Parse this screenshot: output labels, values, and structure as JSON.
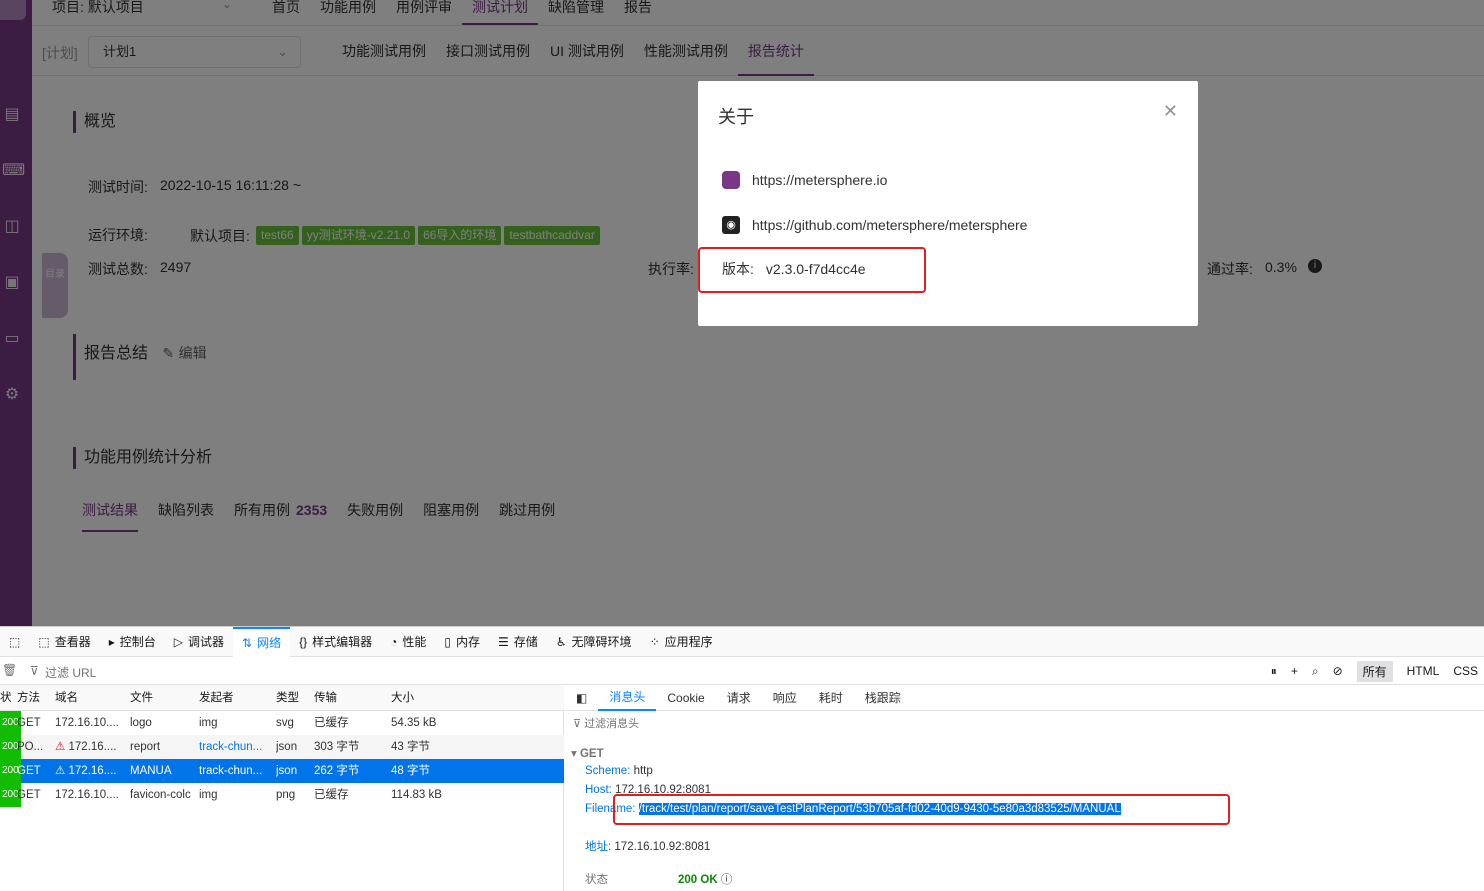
{
  "topbar": {
    "project": "项目: 默认项目",
    "nav": [
      "首页",
      "功能用例",
      "用例评审",
      "测试计划",
      "缺陷管理",
      "报告"
    ]
  },
  "subbar": {
    "plan_tag": "[计划]",
    "plan_value": "计划1",
    "tabs": [
      "功能测试用例",
      "接口测试用例",
      "UI 测试用例",
      "性能测试用例",
      "报告统计"
    ]
  },
  "overview": {
    "title": "概览",
    "test_time_label": "测试时间:",
    "test_time_value": "2022-10-15 16:11:28 ~",
    "env_label": "运行环境:",
    "env_project": "默认项目:",
    "env_tags": [
      "test66",
      "yy测试环境-v2.21.0",
      "66导入的环境",
      "testbathcaddvar"
    ],
    "total_label": "测试总数:",
    "total_value": "2497",
    "exec_label": "执行率:",
    "pass_label": "通过率:",
    "pass_value": "0.3%",
    "directory": "目录"
  },
  "summary": {
    "title": "报告总结",
    "edit": "编辑"
  },
  "analysis": {
    "title": "功能用例统计分析",
    "tabs": [
      "测试结果",
      "缺陷列表",
      "所有用例",
      "失败用例",
      "阻塞用例",
      "跳过用例"
    ],
    "all_count": "2353"
  },
  "dialog": {
    "title": "关于",
    "site": "https://metersphere.io",
    "github": "https://github.com/metersphere/metersphere",
    "version_label": "版本:",
    "version_value": "v2.3.0-f7d4cc4e"
  },
  "devtools": {
    "tabs": [
      "查看器",
      "控制台",
      "调试器",
      "网络",
      "样式编辑器",
      "性能",
      "内存",
      "存储",
      "无障碍环境",
      "应用程序"
    ],
    "filter_placeholder": "过滤 URL",
    "right": [
      "所有",
      "HTML",
      "CSS"
    ],
    "columns": [
      "状",
      "方法",
      "域名",
      "文件",
      "发起者",
      "类型",
      "传输",
      "大小"
    ],
    "rows": [
      {
        "status": "200",
        "method": "GET",
        "domain": "172.16.10....",
        "file": "logo",
        "initiator": "img",
        "type": "svg",
        "transfer": "已缓存",
        "size": "54.35 kB"
      },
      {
        "status": "200",
        "method": "PO...",
        "domain": "172.16....",
        "file": "report",
        "initiator": "track-chun...",
        "type": "json",
        "transfer": "303 字节",
        "size": "43 字节"
      },
      {
        "status": "200",
        "method": "GET",
        "domain": "172.16....",
        "file": "MANUA",
        "initiator": "track-chun...",
        "type": "json",
        "transfer": "262 字节",
        "size": "48 字节"
      },
      {
        "status": "200",
        "method": "GET",
        "domain": "172.16.10....",
        "file": "favicon-colc",
        "initiator": "img",
        "type": "png",
        "transfer": "已缓存",
        "size": "114.83 kB"
      }
    ],
    "detail_tabs": [
      "消息头",
      "Cookie",
      "请求",
      "响应",
      "耗时",
      "栈跟踪"
    ],
    "detail_filter": "过滤消息头",
    "get_label": "GET",
    "scheme_k": "Scheme:",
    "scheme_v": "http",
    "host_k": "Host:",
    "host_v": "172.16.10.92:8081",
    "filename_k": "Filename:",
    "filename_v": "/track/test/plan/report/saveTestPlanReport/53b705af-fd02-40d9-9430-5e80a3d83525/MANUAL",
    "addr_k": "地址:",
    "addr_v": "172.16.10.92:8081",
    "status_k": "状态",
    "status_v": "200 OK"
  }
}
